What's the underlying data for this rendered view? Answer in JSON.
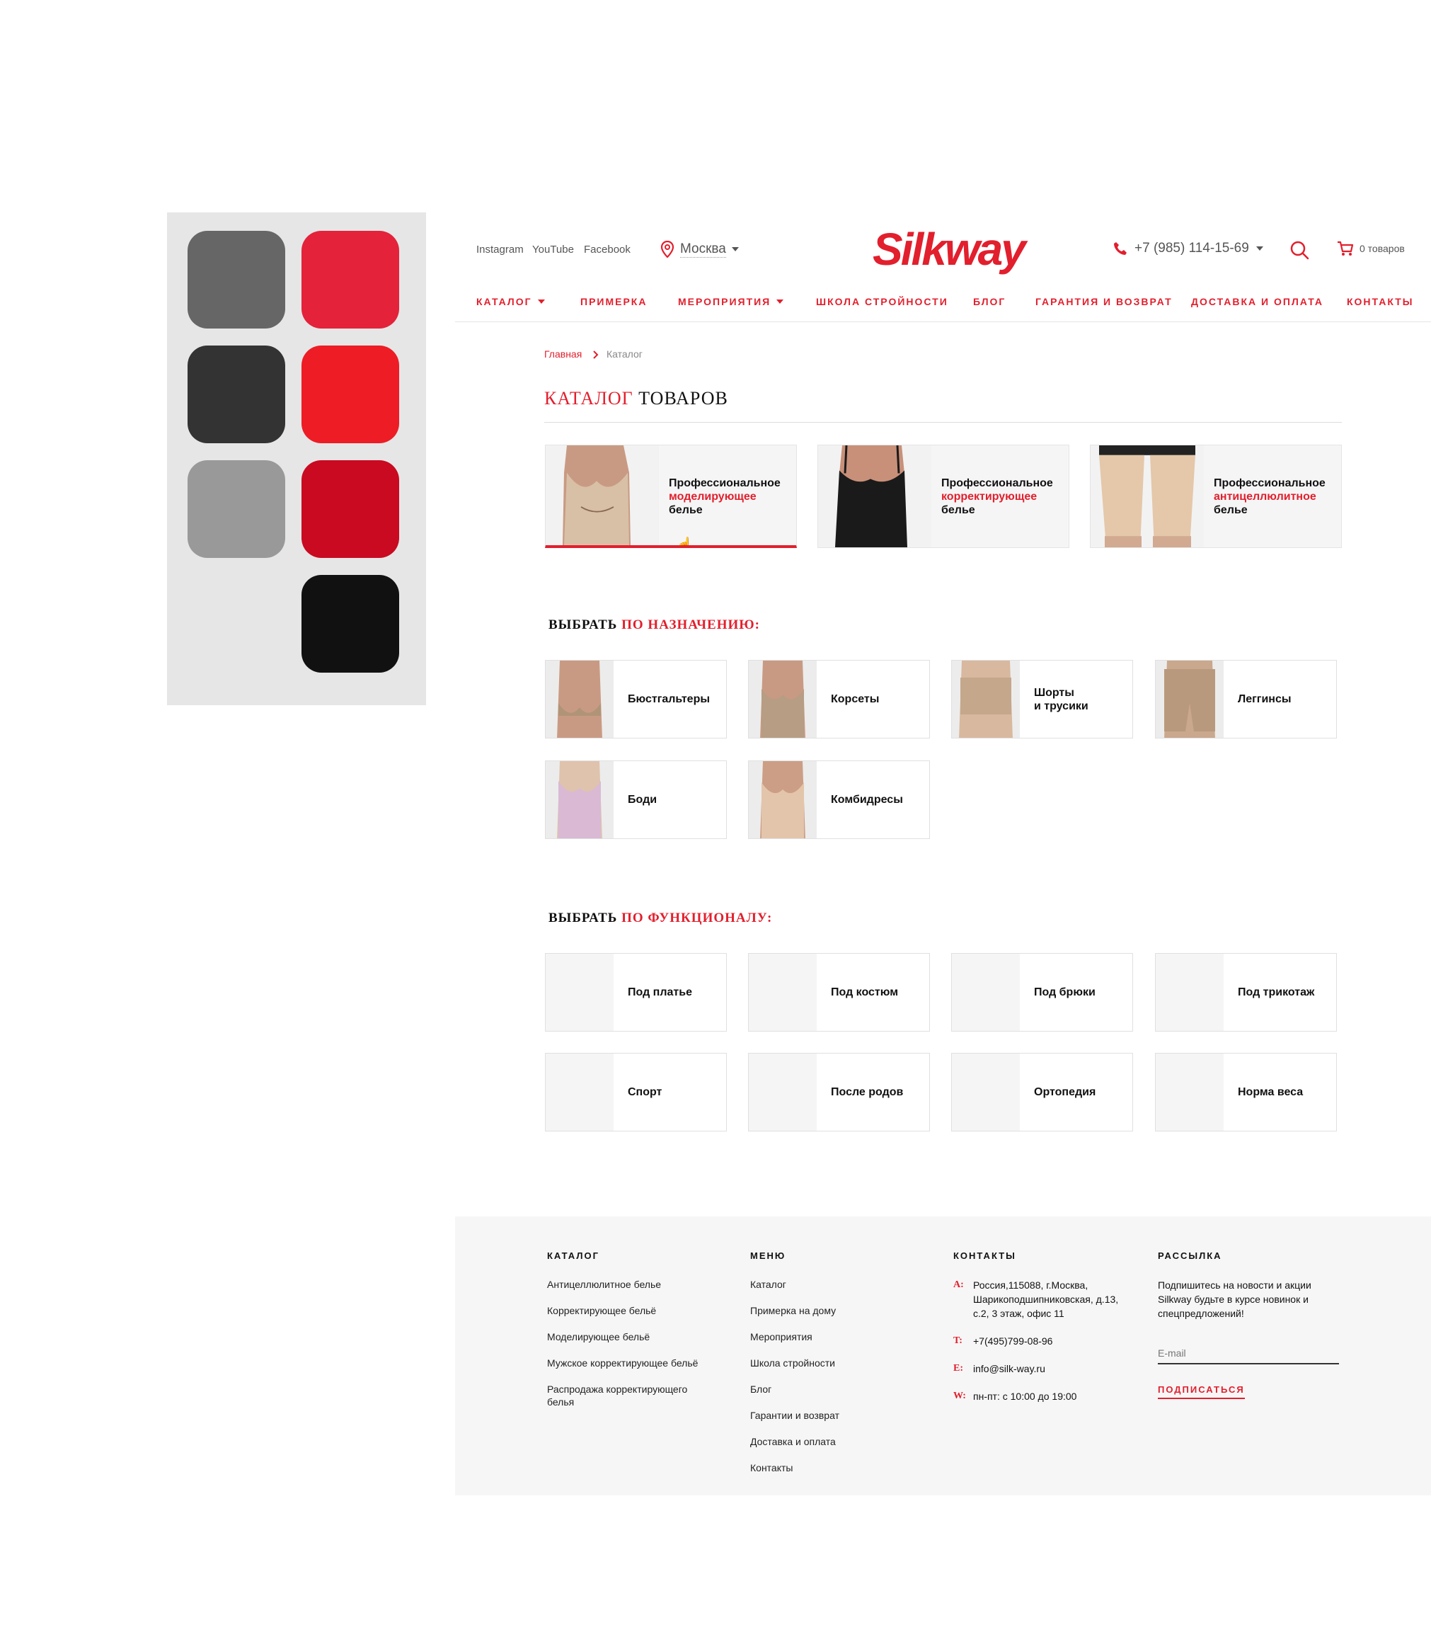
{
  "palette": {
    "colors": [
      "#666666",
      "#e4223a",
      "#333333",
      "#ee1c25",
      "#999999",
      "#c90a21",
      "#111111"
    ]
  },
  "header": {
    "social": [
      "Instagram",
      "YouTube",
      "Facebook"
    ],
    "city": "Москва",
    "logo": "Silkway",
    "phone": "+7 (985) 114-15-69",
    "cart": "0 товаров"
  },
  "nav": {
    "items": [
      "КАТАЛОГ",
      "ПРИМЕРКА",
      "МЕРОПРИЯТИЯ",
      "ШКОЛА СТРОЙНОСТИ",
      "БЛОГ",
      "ГАРАНТИЯ И ВОЗВРАТ",
      "ДОСТАВКА И ОПЛАТА",
      "КОНТАКТЫ"
    ]
  },
  "breadcrumb": {
    "home": "Главная",
    "current": "Каталог"
  },
  "title": {
    "red": "КАТАЛОГ",
    "rest": "ТОВАРОВ"
  },
  "categories": [
    {
      "line1": "Профессиональное",
      "line2": "моделирующее",
      "line3": "белье"
    },
    {
      "line1": "Профессиональное",
      "line2": "корректирующее",
      "line3": "белье"
    },
    {
      "line1": "Профессиональное",
      "line2": "антицеллюлитное",
      "line3": "белье"
    }
  ],
  "purpose": {
    "heading_black": "ВЫБРАТЬ",
    "heading_red": "ПО НАЗНАЧЕНИЮ:",
    "items": [
      "Бюстгальтеры",
      "Корсеты",
      "Шорты",
      "и трусики",
      "Леггинсы",
      "Боди",
      "Комбидресы"
    ]
  },
  "function": {
    "heading_black": "ВЫБРАТЬ",
    "heading_red": "ПО ФУНКЦИОНАЛУ:",
    "items": [
      "Под платье",
      "Под костюм",
      "Под брюки",
      "Под трикотаж",
      "Спорт",
      "После родов",
      "Ортопедия",
      "Норма веса"
    ]
  },
  "footer": {
    "catalog": {
      "heading": "КАТАЛОГ",
      "items": [
        "Антицеллюлитное белье",
        "Корректирующее бельё",
        "Моделирующее бельё",
        "Мужское корректирующее бельё",
        "Распродажа корректирующего",
        "белья"
      ]
    },
    "menu": {
      "heading": "МЕНЮ",
      "items": [
        "Каталог",
        "Примерка на дому",
        "Мероприятия",
        "Школа стройности",
        "Блог",
        "Гарантии и возврат",
        "Доставка и оплата",
        "Контакты"
      ]
    },
    "contacts": {
      "heading": "КОНТАКТЫ",
      "address_key": "A:",
      "address": [
        "Россия,115088, г.Москва,",
        "Шарикоподшипниковская, д.13,",
        "с.2, 3 этаж, офис 11"
      ],
      "phone_key": "T:",
      "phone": "+7(495)799-08-96",
      "email_key": "E:",
      "email": "info@silk-way.ru",
      "hours_key": "W:",
      "hours": "пн-пт: с 10:00 до 19:00"
    },
    "newsletter": {
      "heading": "РАССЫЛКА",
      "text": [
        "Подпишитесь на новости и акции",
        "Silkway будьте в курсе новинок и",
        "спецпредложений!"
      ],
      "placeholder": "E-mail",
      "button": "ПОДПИСАТЬСЯ"
    }
  }
}
